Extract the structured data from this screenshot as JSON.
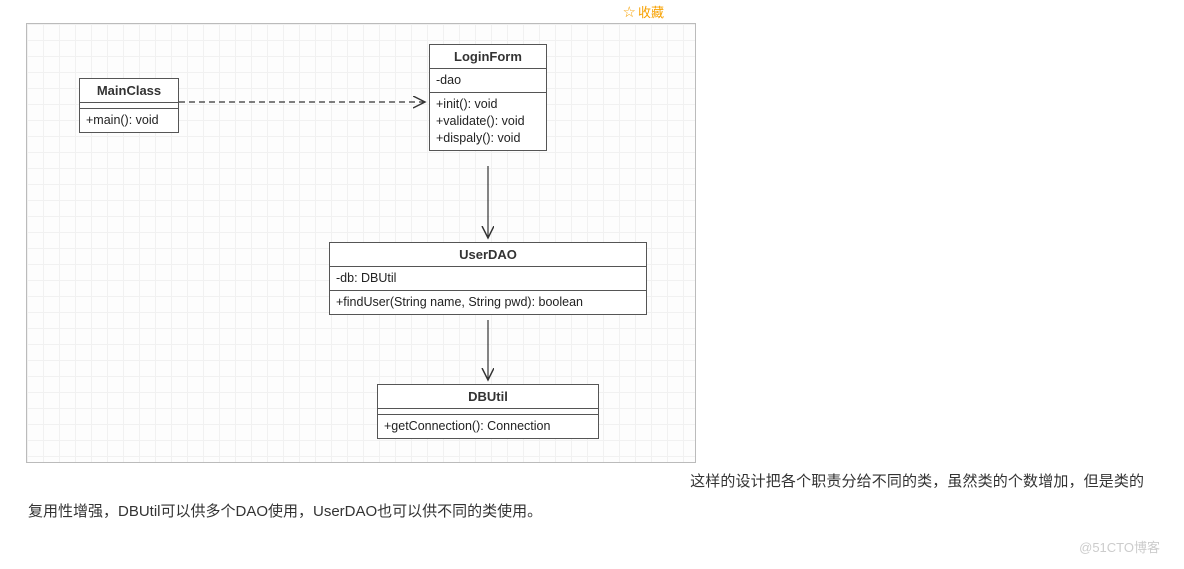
{
  "favorite_label": "收藏",
  "classes": {
    "main": {
      "name": "MainClass",
      "attrs": [],
      "ops": [
        "+main(): void"
      ]
    },
    "login": {
      "name": "LoginForm",
      "attrs": [
        "-dao"
      ],
      "ops": [
        "+init(): void",
        "+validate(): void",
        "+dispaly(): void"
      ]
    },
    "user": {
      "name": "UserDAO",
      "attrs": [
        "-db: DBUtil"
      ],
      "ops": [
        "+findUser(String name, String pwd): boolean"
      ]
    },
    "db": {
      "name": "DBUtil",
      "attrs": [],
      "ops": [
        "+getConnection(): Connection"
      ]
    }
  },
  "relations": [
    {
      "from": "MainClass",
      "to": "LoginForm",
      "style": "dashed-open-arrow",
      "meaning": "dependency"
    },
    {
      "from": "LoginForm",
      "to": "UserDAO",
      "style": "solid-open-arrow",
      "meaning": "association"
    },
    {
      "from": "UserDAO",
      "to": "DBUtil",
      "style": "solid-open-arrow",
      "meaning": "association"
    }
  ],
  "description_text": "这样的设计把各个职责分给不同的类，虽然类的个数增加，但是类的复用性增强，DBUtil可以供多个DAO使用，UserDAO也可以供不同的类使用。",
  "watermark": "@51CTO博客"
}
